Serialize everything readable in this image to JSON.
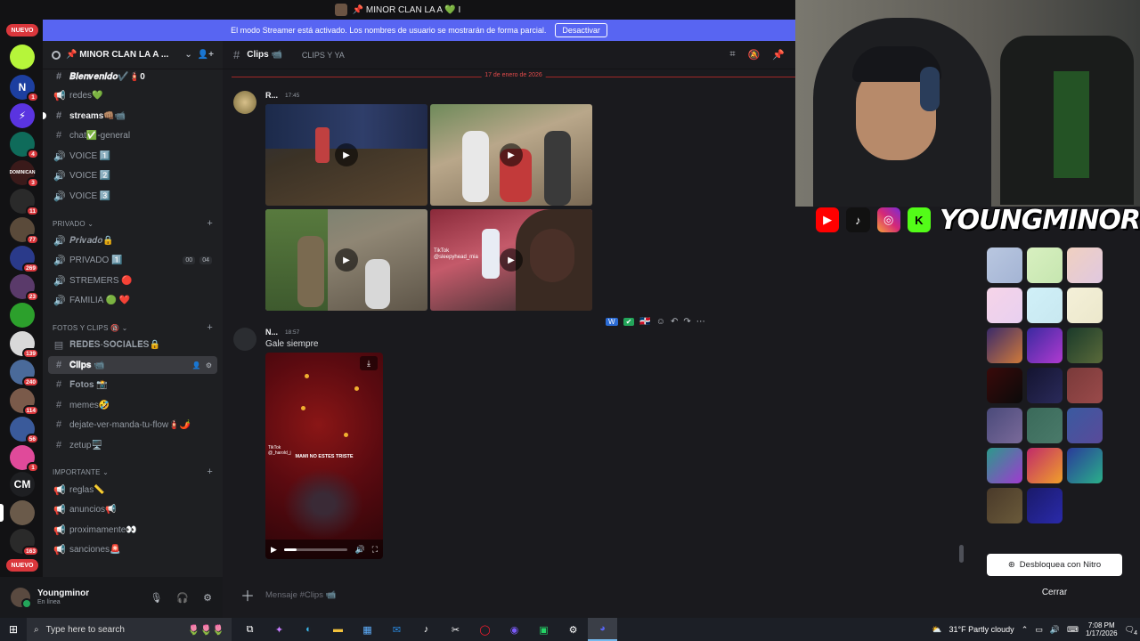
{
  "window": {
    "title": "📌 MINOR CLAN LA A 💚 I"
  },
  "banner": {
    "text": "El modo Streamer está activado. Los nombres de usuario se mostrarán de forma parcial.",
    "button": "Desactivar"
  },
  "rail": {
    "nuevo_top": "NUEVO",
    "nuevo_bottom": "NUEVO",
    "servers": [
      {
        "label": "",
        "badge": ""
      },
      {
        "label": "N",
        "badge": "1"
      },
      {
        "label": "⚡",
        "badge": ""
      },
      {
        "label": "",
        "badge": "4"
      },
      {
        "label": "DOMINICAN",
        "badge": "3"
      },
      {
        "label": "",
        "badge": "11"
      },
      {
        "label": "",
        "badge": "77"
      },
      {
        "label": "",
        "badge": "269"
      },
      {
        "label": "",
        "badge": "23"
      },
      {
        "label": "",
        "badge": ""
      },
      {
        "label": "",
        "badge": "139"
      },
      {
        "label": "",
        "badge": "240"
      },
      {
        "label": "",
        "badge": "114"
      },
      {
        "label": "",
        "badge": "56"
      },
      {
        "label": "",
        "badge": "1"
      },
      {
        "label": "CM",
        "badge": ""
      },
      {
        "label": "",
        "badge": ""
      },
      {
        "label": "",
        "badge": "163"
      }
    ]
  },
  "server": {
    "name": "📌 MINOR CLAN LA A ..."
  },
  "channels": {
    "top": [
      {
        "sym": "#",
        "name": "𝑩𝒊𝒆𝒏𝒗𝒆𝒏𝒊𝒅𝒐✔️🧯0"
      },
      {
        "sym": "📢",
        "name": "redes💚"
      },
      {
        "sym": "#",
        "name": "streams👊🏽📹"
      },
      {
        "sym": "#",
        "name": "chat✅-general"
      },
      {
        "sym": "🔊",
        "name": "VOICE 1️⃣"
      },
      {
        "sym": "🔊",
        "name": "VOICE 2️⃣"
      },
      {
        "sym": "🔊",
        "name": "VOICE 3️⃣"
      }
    ],
    "cat_privado": "PRIVADO",
    "privado": [
      {
        "sym": "🔊",
        "name": "𝑷𝒓𝒊𝒗𝒂𝒅𝒐🔒"
      },
      {
        "sym": "🔊",
        "name": "PRIVADO 1️⃣",
        "pill1": "00",
        "pill2": "04"
      },
      {
        "sym": "🔊",
        "name": "STREMERS 🔴"
      },
      {
        "sym": "🔊",
        "name": "FAMILIA 🟢 ❤️"
      }
    ],
    "cat_fotos": "FOTOS Y CLIPS 🔞",
    "fotos": [
      {
        "sym": "▤",
        "name": "𝐑𝐄𝐃𝐄𝐒-𝐒𝐎𝐂𝐈𝐀𝐋𝐄𝐒🔒"
      },
      {
        "sym": "#",
        "name": "𝐂𝐥𝐢𝐩𝐬 📹"
      },
      {
        "sym": "#",
        "name": "𝐅𝐨𝐭𝐨𝐬 📸"
      },
      {
        "sym": "#",
        "name": "memes🤣"
      },
      {
        "sym": "#",
        "name": "dejate-ver-manda-tu-flow🧯🌶️"
      },
      {
        "sym": "#",
        "name": "zetup🖥️"
      }
    ],
    "cat_importante": "IMPORTANTE",
    "importante": [
      {
        "sym": "📢",
        "name": "reglas📏"
      },
      {
        "sym": "📢",
        "name": "anuncios📢"
      },
      {
        "sym": "📢",
        "name": "proximamente👀"
      },
      {
        "sym": "📢",
        "name": "sanciones🚨"
      }
    ]
  },
  "user": {
    "name": "Youngminor",
    "status": "En línea"
  },
  "chat": {
    "channel": "Clips 📹",
    "topic": "CLIPS Y YA",
    "date_divider": "17 de enero de 2026",
    "msg1": {
      "author": "R...",
      "time": "17:45"
    },
    "msg2": {
      "author": "N...",
      "time": "18:57",
      "text": "Gale siempre"
    },
    "video": {
      "caption": "MAMI NO ESTES TRISTE",
      "tiktok": "TikTok",
      "tiktok_handle": "@_harold_j"
    },
    "thumb_tiktok": "TikTok",
    "thumb_tiktok_handle": "@sleepyhead_mia",
    "composer_placeholder": "Mensaje #Clips 📹"
  },
  "overlay": {
    "brand": "YOUNGMINOR",
    "nitro_button": "Desbloquea con Nitro",
    "close": "Cerrar"
  },
  "taskbar": {
    "search": "Type here to search",
    "weather": "31°F  Partly cloudy",
    "time": "7:08 PM",
    "date": "1/17/2026",
    "notif": "4"
  }
}
